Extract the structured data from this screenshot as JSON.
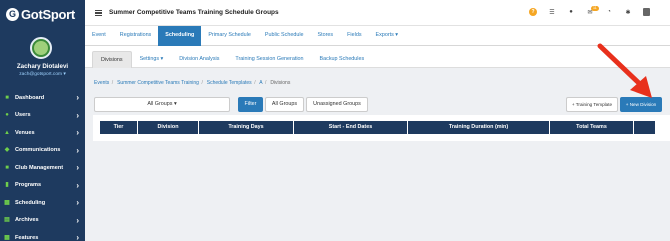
{
  "app": {
    "logo_text": "GotSport"
  },
  "sidebar": {
    "user_name": "Zachary Diotalevi",
    "user_email": "zach@gotsport.com",
    "items": [
      {
        "label": "Dashboard",
        "icon": "dashboard-icon"
      },
      {
        "label": "Users",
        "icon": "users-icon"
      },
      {
        "label": "Venues",
        "icon": "venues-icon"
      },
      {
        "label": "Communications",
        "icon": "communications-icon"
      },
      {
        "label": "Club Management",
        "icon": "club-management-icon"
      },
      {
        "label": "Programs",
        "icon": "programs-icon"
      },
      {
        "label": "Scheduling",
        "icon": "scheduling-icon"
      },
      {
        "label": "Archives",
        "icon": "archives-icon"
      },
      {
        "label": "Features",
        "icon": "features-icon"
      }
    ]
  },
  "header": {
    "title": "Summer Competitive Teams Training Schedule Groups",
    "notification_count": "11"
  },
  "tabs_primary": [
    {
      "label": "Event",
      "active": false
    },
    {
      "label": "Registrations",
      "active": false
    },
    {
      "label": "Scheduling",
      "active": true
    },
    {
      "label": "Primary Schedule",
      "active": false
    },
    {
      "label": "Public Schedule",
      "active": false
    },
    {
      "label": "Stores",
      "active": false
    },
    {
      "label": "Fields",
      "active": false
    },
    {
      "label": "Exports ▾",
      "active": false
    }
  ],
  "tabs_secondary": [
    {
      "label": "Divisions",
      "active": true
    },
    {
      "label": "Settings ▾",
      "active": false
    },
    {
      "label": "Division Analysis",
      "active": false
    },
    {
      "label": "Training Session Generation",
      "active": false
    },
    {
      "label": "Backup Schedules",
      "active": false
    }
  ],
  "breadcrumb": {
    "items": [
      "Events",
      "Summer Competitive Teams Training",
      "Schedule Templates",
      "A"
    ],
    "current": "Divisions"
  },
  "controls": {
    "group_select": "All Groups ▾",
    "filter_label": "Filter",
    "all_groups_label": "All Groups",
    "unassigned_label": "Unassigned Groups",
    "training_template_label": "+ Training Template",
    "new_division_label": "+ New Division"
  },
  "table": {
    "columns": [
      "Tier",
      "Division",
      "Training Days",
      "Start - End Dates",
      "Training Duration (min)",
      "Total Teams",
      ""
    ]
  },
  "colors": {
    "sidebar_bg": "#1e3a5f",
    "accent_blue": "#2a7ab8",
    "icon_green": "#6fcf4b",
    "arrow_red": "#e8301c"
  }
}
